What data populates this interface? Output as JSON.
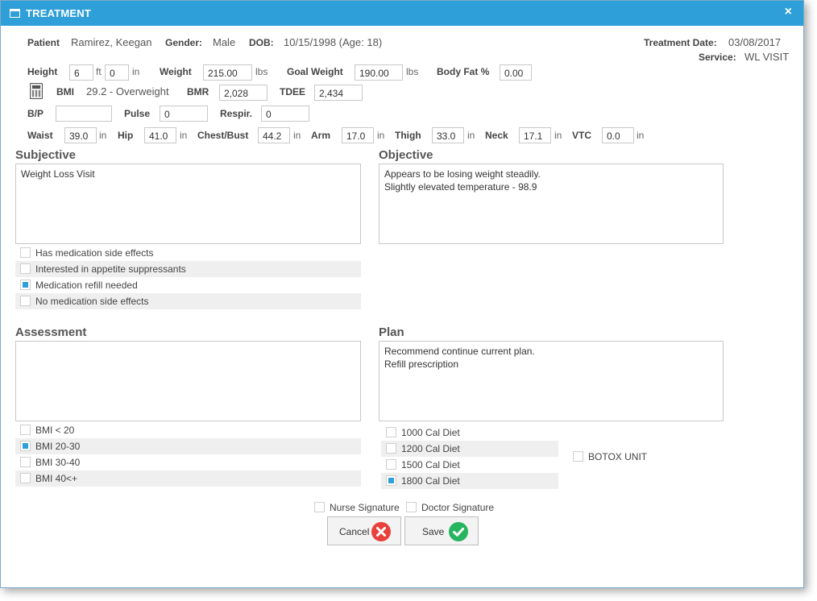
{
  "window": {
    "title": "TREATMENT",
    "close_glyph": "×"
  },
  "patient": {
    "patient_label": "Patient",
    "patient_value": "Ramirez, Keegan",
    "gender_label": "Gender:",
    "gender_value": "Male",
    "dob_label": "DOB:",
    "dob_value": "10/15/1998 (Age: 18)",
    "treatment_date_label": "Treatment Date:",
    "treatment_date_value": "03/08/2017",
    "service_label": "Service:",
    "service_value": "WL VISIT"
  },
  "vitals": {
    "height_label": "Height",
    "height_ft": "6",
    "ft_unit": "ft",
    "height_in": "0",
    "in_unit": "in",
    "weight_label": "Weight",
    "weight_value": "215.00",
    "weight_unit": "lbs",
    "goal_weight_label": "Goal Weight",
    "goal_weight_value": "190.00",
    "goal_weight_unit": "lbs",
    "body_fat_label": "Body Fat %",
    "body_fat_value": "0.00",
    "bmi_label": "BMI",
    "bmi_value": "29.2 - Overweight",
    "bmr_label": "BMR",
    "bmr_value": "2,028",
    "tdee_label": "TDEE",
    "tdee_value": "2,434",
    "bp_label": "B/P",
    "bp_value": "",
    "pulse_label": "Pulse",
    "pulse_value": "0",
    "respir_label": "Respir.",
    "respir_value": "0"
  },
  "measurements": {
    "waist_label": "Waist",
    "waist_value": "39.0",
    "hip_label": "Hip",
    "hip_value": "41.0",
    "chest_label": "Chest/Bust",
    "chest_value": "44.2",
    "arm_label": "Arm",
    "arm_value": "17.0",
    "thigh_label": "Thigh",
    "thigh_value": "33.0",
    "neck_label": "Neck",
    "neck_value": "17.1",
    "vtc_label": "VTC",
    "vtc_value": "0.0",
    "unit": "in"
  },
  "subjective": {
    "title": "Subjective",
    "lines": [
      "Weight Loss Visit"
    ],
    "options": [
      {
        "label": "Has medication side effects",
        "checked": false
      },
      {
        "label": "Interested in appetite suppressants",
        "checked": false
      },
      {
        "label": "Medication refill needed",
        "checked": true
      },
      {
        "label": "No medication side effects",
        "checked": false
      }
    ]
  },
  "objective": {
    "title": "Objective",
    "lines": [
      "Appears to be losing weight steadily.",
      "Slightly elevated temperature - 98.9"
    ]
  },
  "assessment": {
    "title": "Assessment",
    "lines": [],
    "options": [
      {
        "label": "BMI < 20",
        "checked": false
      },
      {
        "label": "BMI 20-30",
        "checked": true
      },
      {
        "label": "BMI 30-40",
        "checked": false
      },
      {
        "label": "BMI 40<+",
        "checked": false
      }
    ]
  },
  "plan": {
    "title": "Plan",
    "lines": [
      "Recommend continue current plan.",
      "Refill prescription"
    ],
    "options": [
      {
        "label": "1000 Cal Diet",
        "checked": false
      },
      {
        "label": "1200 Cal Diet",
        "checked": false
      },
      {
        "label": "1500 Cal Diet",
        "checked": false
      },
      {
        "label": "1800 Cal Diet",
        "checked": true
      }
    ],
    "botox": {
      "label": "BOTOX UNIT",
      "checked": false
    }
  },
  "signatures": {
    "nurse": {
      "label": "Nurse Signature",
      "checked": false
    },
    "doctor": {
      "label": "Doctor Signature",
      "checked": false
    }
  },
  "buttons": {
    "cancel_label": "Cancel",
    "save_label": "Save",
    "cancel_icon": "cancel-x-icon",
    "save_icon": "save-check-icon"
  },
  "colors": {
    "accent": "#2e9fd8",
    "cancel_red": "#e8403a",
    "save_green": "#27b560",
    "shade": "#efefef"
  }
}
